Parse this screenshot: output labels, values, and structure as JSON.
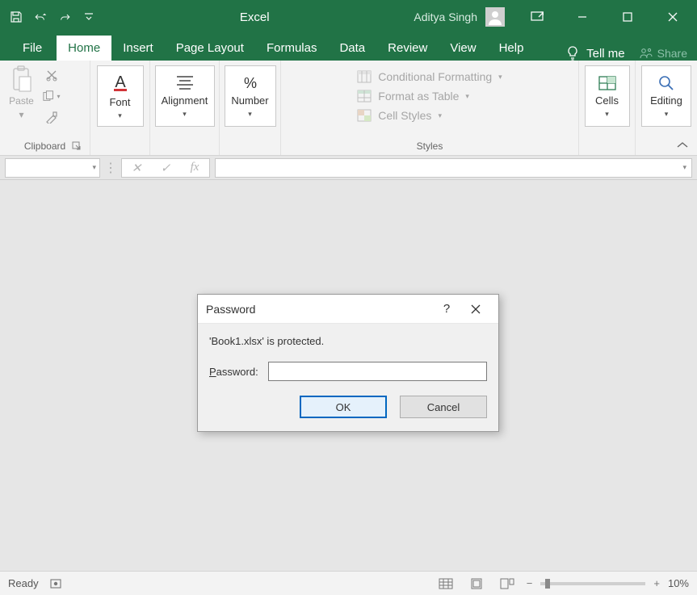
{
  "title": "Excel",
  "user": "Aditya Singh",
  "tabs": {
    "file": "File",
    "home": "Home",
    "insert": "Insert",
    "pagelayout": "Page Layout",
    "formulas": "Formulas",
    "data": "Data",
    "review": "Review",
    "view": "View",
    "help": "Help",
    "tellme": "Tell me",
    "share": "Share"
  },
  "ribbon": {
    "clipboard": {
      "label": "Clipboard",
      "paste": "Paste"
    },
    "font": {
      "btn": "Font"
    },
    "alignment": {
      "btn": "Alignment"
    },
    "number": {
      "btn": "Number"
    },
    "styles": {
      "label": "Styles",
      "cond": "Conditional Formatting",
      "table": "Format as Table",
      "cell": "Cell Styles"
    },
    "cells": {
      "btn": "Cells"
    },
    "editing": {
      "btn": "Editing"
    }
  },
  "formula_bar": {
    "name_box": "",
    "formula": ""
  },
  "dialog": {
    "title": "Password",
    "message": "'Book1.xlsx' is protected.",
    "label_prefix": "P",
    "label_rest": "assword:",
    "value": "",
    "ok": "OK",
    "cancel": "Cancel"
  },
  "status": {
    "ready": "Ready",
    "zoom": "10%"
  }
}
